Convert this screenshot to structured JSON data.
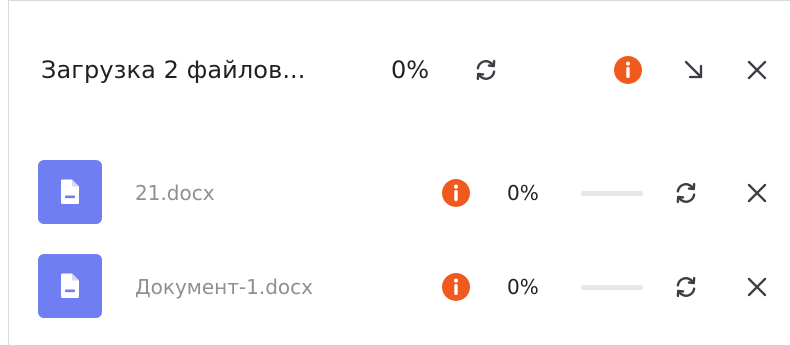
{
  "header": {
    "title": "Загрузка 2 файлов...",
    "percent": "0%",
    "icons": {
      "refresh": "refresh-icon",
      "info": "info-icon",
      "minimize": "minimize-arrow-icon",
      "close": "close-icon"
    }
  },
  "files": [
    {
      "name": "21.docx",
      "percent": "0%",
      "progress": 0
    },
    {
      "name": "Документ-1.docx",
      "percent": "0%",
      "progress": 0
    }
  ],
  "colors": {
    "accent": "#6f7ef0",
    "warning": "#f05a1e",
    "text": "#1f2125",
    "muted": "#8d9096",
    "icon": "#3a3d44",
    "track": "#e6e7ea"
  }
}
